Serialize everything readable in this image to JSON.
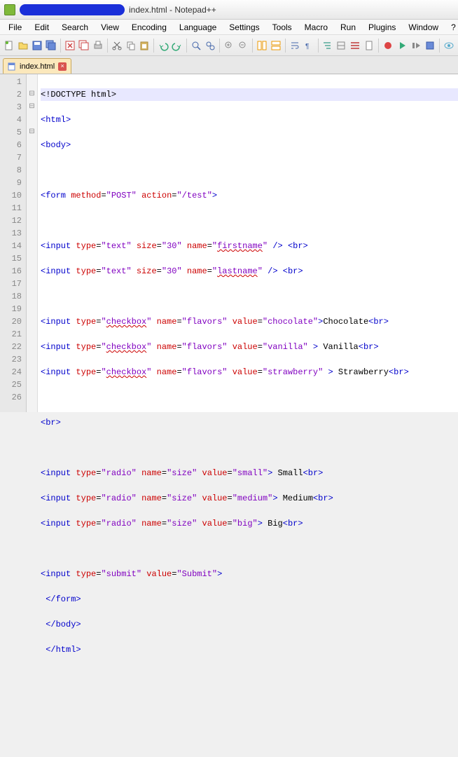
{
  "titlebar": {
    "filename": "index.html",
    "app": "Notepad++"
  },
  "menu": [
    "File",
    "Edit",
    "Search",
    "View",
    "Encoding",
    "Language",
    "Settings",
    "Tools",
    "Macro",
    "Run",
    "Plugins",
    "Window",
    "?"
  ],
  "tab": {
    "label": "index.html"
  },
  "lines": [
    "1",
    "2",
    "3",
    "4",
    "5",
    "6",
    "7",
    "8",
    "9",
    "10",
    "11",
    "12",
    "13",
    "14",
    "15",
    "16",
    "17",
    "18",
    "19",
    "20",
    "21",
    "22",
    "23",
    "24",
    "25",
    "26"
  ],
  "folds": [
    "",
    "⊟",
    "⊟",
    "",
    "⊟",
    "",
    "",
    "",
    "",
    "",
    "",
    "",
    "",
    "",
    "",
    "",
    "",
    "",
    "",
    "",
    "",
    "",
    "",
    "",
    "",
    ""
  ],
  "code": {
    "l1_doc": "<!DOCTYPE html>",
    "html": "html",
    "body": "body",
    "form": "form",
    "input": "input",
    "br": "br",
    "method": "method",
    "post": "\"POST\"",
    "action": "action",
    "test": "\"/test\"",
    "type": "type",
    "text": "\"text\"",
    "size": "size",
    "s30": "\"30\"",
    "name": "name",
    "firstname": "firstname",
    "lastname": "lastname",
    "checkbox": "checkbox",
    "flavors": "\"flavors\"",
    "value": "value",
    "chocolate": "\"chocolate\"",
    "vanilla": "\"vanilla\"",
    "strawberry": "\"strawberry\"",
    "txt_choc": "Chocolate",
    "txt_van": " Vanilla",
    "txt_straw": " Strawberry",
    "radio": "\"radio\"",
    "sizeq": "\"size\"",
    "small": "\"small\"",
    "medium": "\"medium\"",
    "big": "\"big\"",
    "txt_small": " Small",
    "txt_med": " Medium",
    "txt_big": " Big",
    "submit": "\"submit\"",
    "submitv": "\"Submit\""
  }
}
